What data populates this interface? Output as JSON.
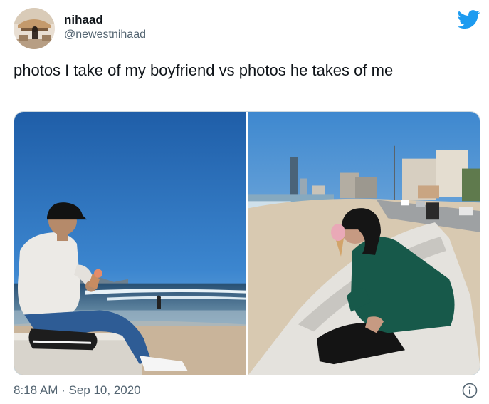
{
  "tweet": {
    "author_name": "nihaad",
    "author_handle": "@newestnihaad",
    "text": "photos I take of my boyfriend vs photos he takes of me",
    "timestamp": "8:18 AM · Sep 10, 2020"
  },
  "icons": {
    "brand": "twitter-bird-icon",
    "info": "info-icon"
  },
  "colors": {
    "twitter_blue": "#1d9bf0",
    "secondary_text": "#536471",
    "primary_text": "#0f1419"
  }
}
